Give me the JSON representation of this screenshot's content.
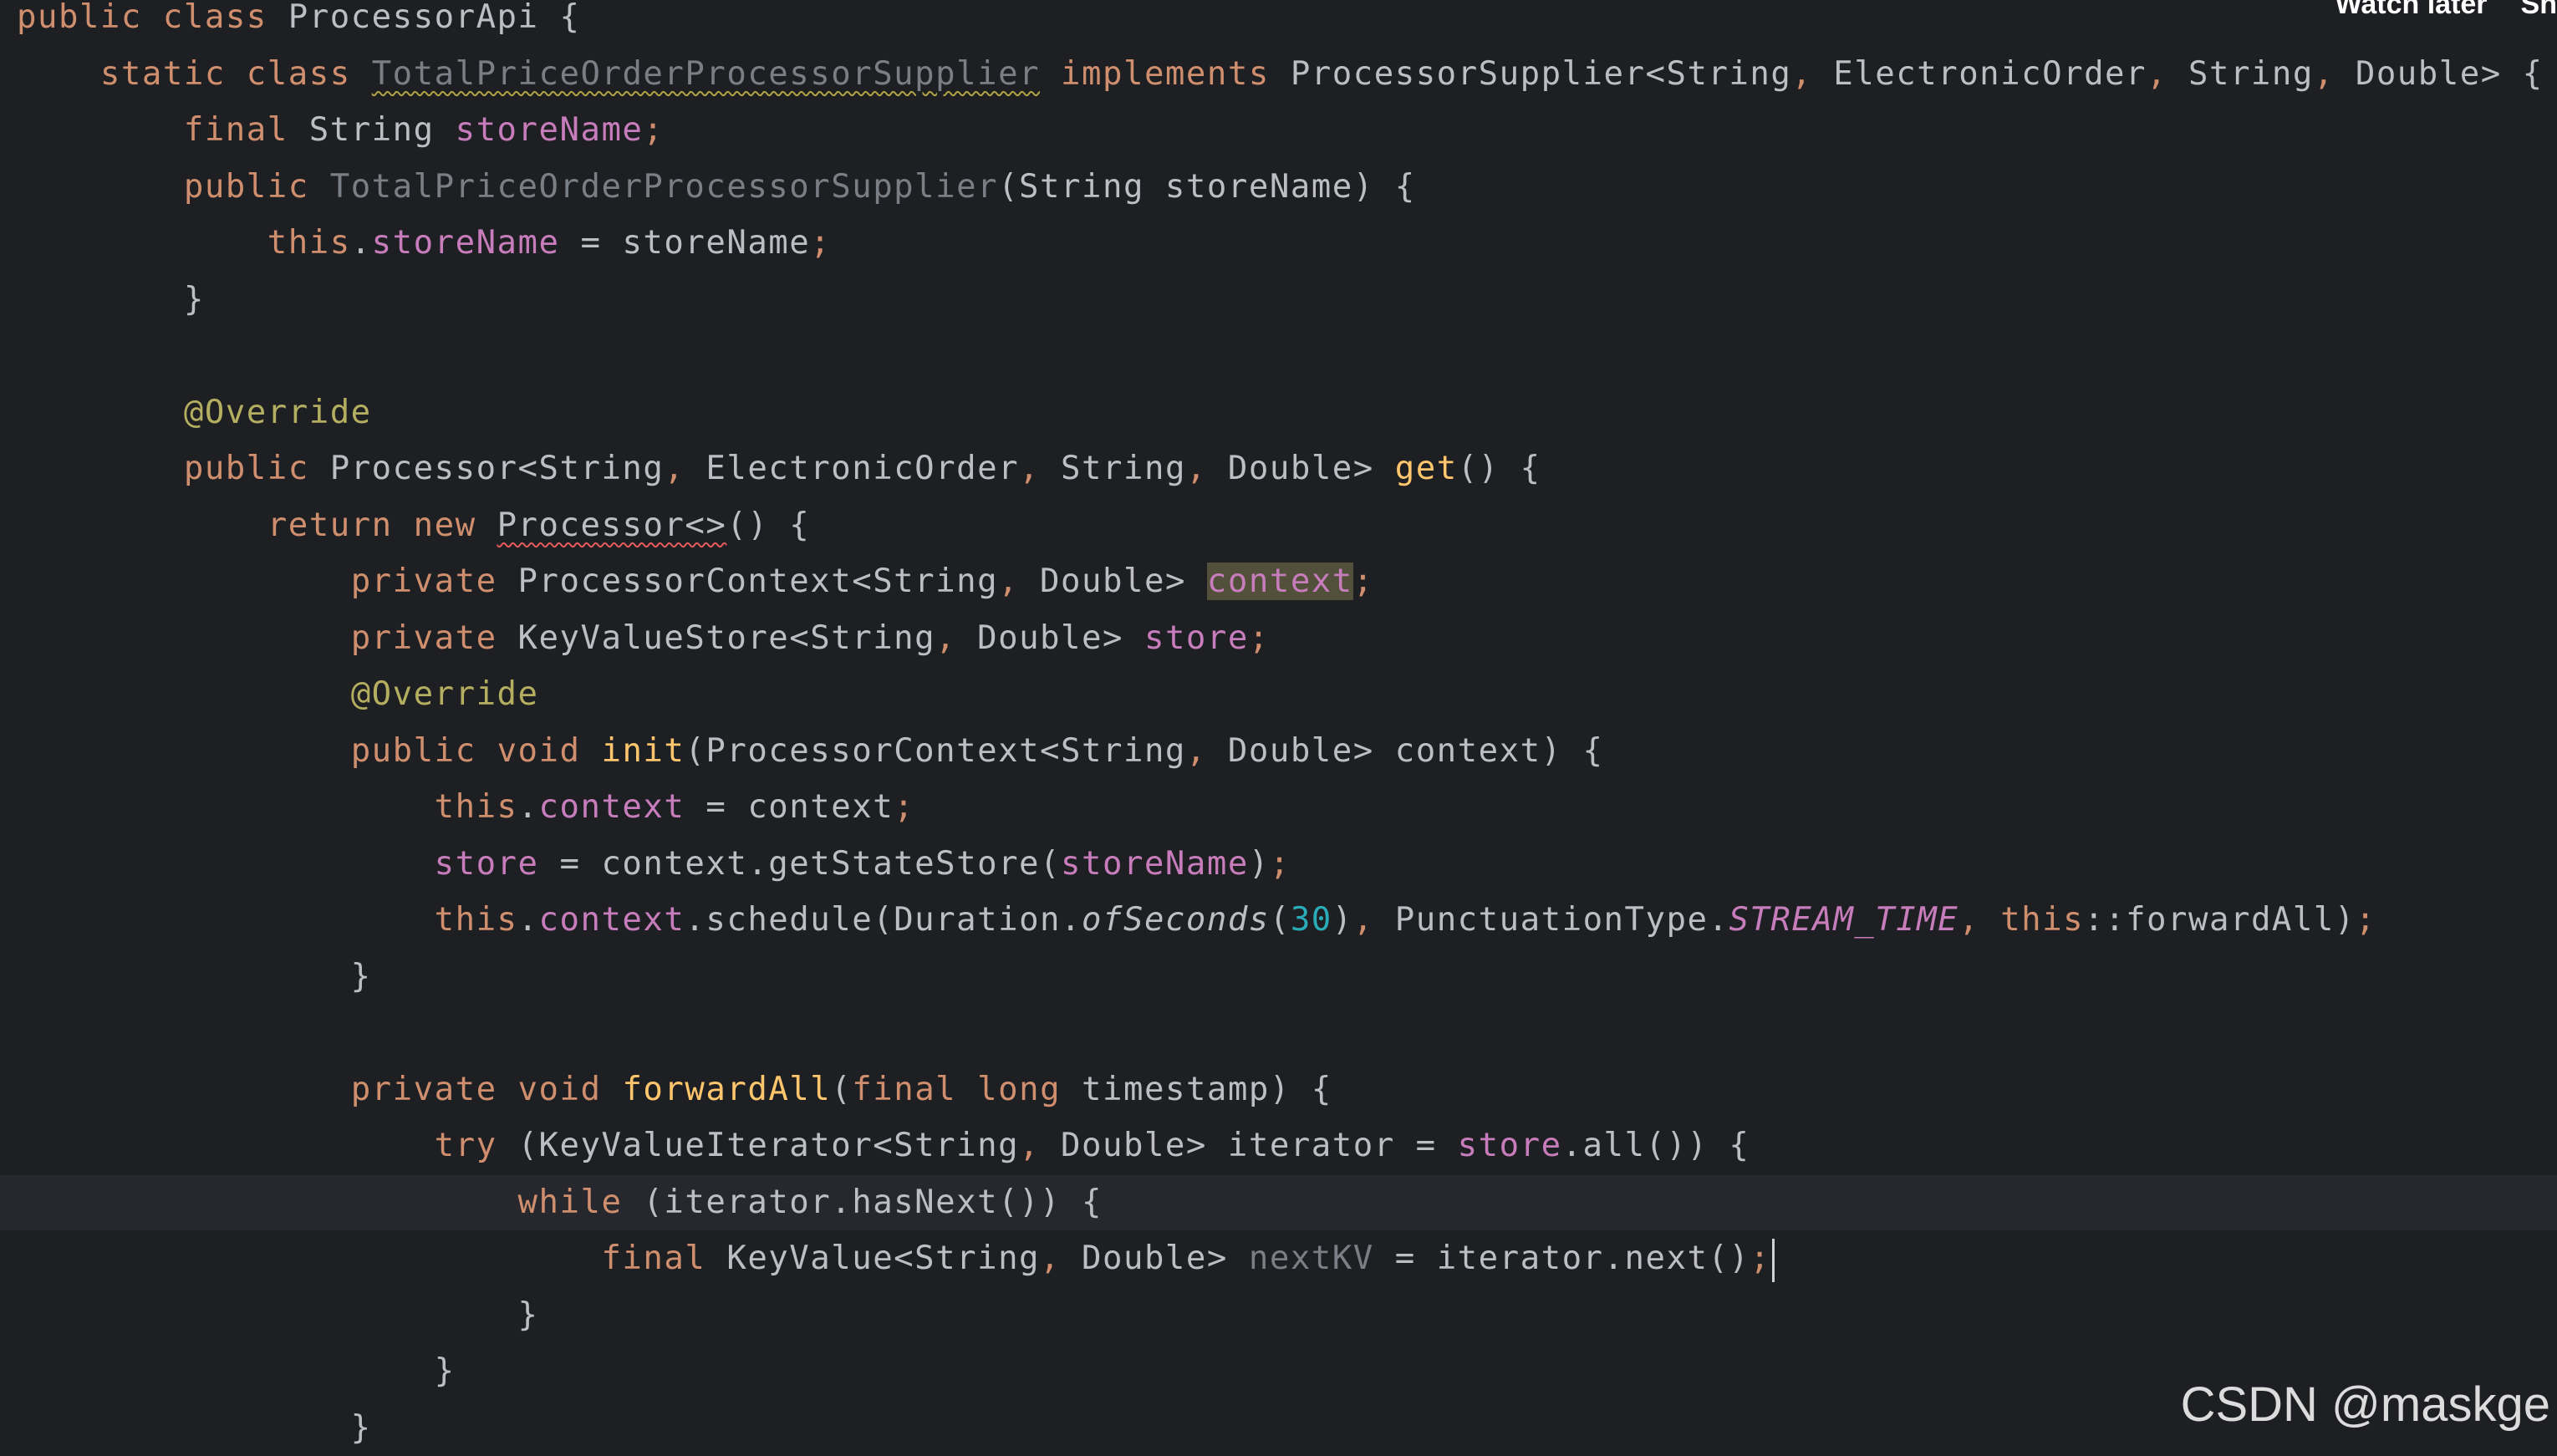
{
  "overlay": {
    "watch_later": "Watch later",
    "share_truncated": "Sh"
  },
  "watermark": "CSDN @maskge",
  "colors": {
    "background": "#1e1f22",
    "keyword": "#cf8e6d",
    "identifier": "#bcbec4",
    "method_declaration": "#ffc66d",
    "field": "#c77dbb",
    "annotation": "#b3ae60",
    "number": "#2aacb8",
    "unused": "#7a7e85"
  },
  "editor": {
    "current_line_index": 21,
    "lines": [
      [
        [
          "kw",
          "public"
        ],
        [
          "id",
          " "
        ],
        [
          "kw",
          "class"
        ],
        [
          "id",
          " ProcessorApi {"
        ]
      ],
      [
        [
          "id",
          "    "
        ],
        [
          "kw",
          "static"
        ],
        [
          "id",
          " "
        ],
        [
          "kw",
          "class"
        ],
        [
          "id",
          " "
        ],
        [
          "unused-warn",
          "TotalPriceOrderProcessorSupplier"
        ],
        [
          "id",
          " "
        ],
        [
          "kw",
          "implements"
        ],
        [
          "id",
          " ProcessorSupplier<String"
        ],
        [
          "comma",
          ","
        ],
        [
          "id",
          " ElectronicOrder"
        ],
        [
          "comma",
          ","
        ],
        [
          "id",
          " String"
        ],
        [
          "comma",
          ","
        ],
        [
          "id",
          " Double> {"
        ]
      ],
      [
        [
          "id",
          "        "
        ],
        [
          "kw",
          "final"
        ],
        [
          "id",
          " String "
        ],
        [
          "field",
          "storeName"
        ],
        [
          "semi",
          ";"
        ]
      ],
      [
        [
          "id",
          "        "
        ],
        [
          "kw",
          "public"
        ],
        [
          "id",
          " "
        ],
        [
          "unused",
          "TotalPriceOrderProcessorSupplier"
        ],
        [
          "id",
          "(String storeName) {"
        ]
      ],
      [
        [
          "id",
          "            "
        ],
        [
          "kw",
          "this"
        ],
        [
          "id",
          "."
        ],
        [
          "field",
          "storeName"
        ],
        [
          "id",
          " = storeName"
        ],
        [
          "semi",
          ";"
        ]
      ],
      [
        [
          "id",
          "        }"
        ]
      ],
      [
        [
          "id",
          ""
        ]
      ],
      [
        [
          "id",
          "        "
        ],
        [
          "anno",
          "@Override"
        ]
      ],
      [
        [
          "id",
          "        "
        ],
        [
          "kw",
          "public"
        ],
        [
          "id",
          " Processor<String"
        ],
        [
          "comma",
          ","
        ],
        [
          "id",
          " ElectronicOrder"
        ],
        [
          "comma",
          ","
        ],
        [
          "id",
          " String"
        ],
        [
          "comma",
          ","
        ],
        [
          "id",
          " Double> "
        ],
        [
          "mdecl",
          "get"
        ],
        [
          "id",
          "() {"
        ]
      ],
      [
        [
          "id",
          "            "
        ],
        [
          "kw",
          "return"
        ],
        [
          "id",
          " "
        ],
        [
          "kw",
          "new"
        ],
        [
          "id",
          " "
        ],
        [
          "err",
          "Processor<>"
        ],
        [
          "id",
          "() {"
        ]
      ],
      [
        [
          "id",
          "                "
        ],
        [
          "kw",
          "private"
        ],
        [
          "id",
          " ProcessorContext<String"
        ],
        [
          "comma",
          ","
        ],
        [
          "id",
          " Double> "
        ],
        [
          "field-hl",
          "context"
        ],
        [
          "semi",
          ";"
        ]
      ],
      [
        [
          "id",
          "                "
        ],
        [
          "kw",
          "private"
        ],
        [
          "id",
          " KeyValueStore<String"
        ],
        [
          "comma",
          ","
        ],
        [
          "id",
          " Double> "
        ],
        [
          "field",
          "store"
        ],
        [
          "semi",
          ";"
        ]
      ],
      [
        [
          "id",
          "                "
        ],
        [
          "anno",
          "@Override"
        ]
      ],
      [
        [
          "id",
          "                "
        ],
        [
          "kw",
          "public"
        ],
        [
          "id",
          " "
        ],
        [
          "kw",
          "void"
        ],
        [
          "id",
          " "
        ],
        [
          "mdecl",
          "init"
        ],
        [
          "id",
          "(ProcessorContext<String"
        ],
        [
          "comma",
          ","
        ],
        [
          "id",
          " Double> context) {"
        ]
      ],
      [
        [
          "id",
          "                    "
        ],
        [
          "kw",
          "this"
        ],
        [
          "id",
          "."
        ],
        [
          "field",
          "context"
        ],
        [
          "id",
          " = context"
        ],
        [
          "semi",
          ";"
        ]
      ],
      [
        [
          "id",
          "                    "
        ],
        [
          "field",
          "store"
        ],
        [
          "id",
          " = context.getStateStore("
        ],
        [
          "field",
          "storeName"
        ],
        [
          "id",
          ")"
        ],
        [
          "semi",
          ";"
        ]
      ],
      [
        [
          "id",
          "                    "
        ],
        [
          "kw",
          "this"
        ],
        [
          "id",
          "."
        ],
        [
          "field",
          "context"
        ],
        [
          "id",
          ".schedule(Duration."
        ],
        [
          "scall",
          "ofSeconds"
        ],
        [
          "id",
          "("
        ],
        [
          "num",
          "30"
        ],
        [
          "id",
          ")"
        ],
        [
          "comma",
          ","
        ],
        [
          "id",
          " PunctuationType."
        ],
        [
          "static",
          "STREAM_TIME"
        ],
        [
          "comma",
          ","
        ],
        [
          "id",
          " "
        ],
        [
          "kw",
          "this"
        ],
        [
          "id",
          "::forwardAll)"
        ],
        [
          "semi",
          ";"
        ]
      ],
      [
        [
          "id",
          "                }"
        ]
      ],
      [
        [
          "id",
          ""
        ]
      ],
      [
        [
          "id",
          "                "
        ],
        [
          "kw",
          "private"
        ],
        [
          "id",
          " "
        ],
        [
          "kw",
          "void"
        ],
        [
          "id",
          " "
        ],
        [
          "mdecl",
          "forwardAll"
        ],
        [
          "id",
          "("
        ],
        [
          "kw",
          "final"
        ],
        [
          "id",
          " "
        ],
        [
          "kw",
          "long"
        ],
        [
          "id",
          " timestamp) {"
        ]
      ],
      [
        [
          "id",
          "                    "
        ],
        [
          "kw",
          "try"
        ],
        [
          "id",
          " (KeyValueIterator<String"
        ],
        [
          "comma",
          ","
        ],
        [
          "id",
          " Double> iterator = "
        ],
        [
          "field",
          "store"
        ],
        [
          "id",
          ".all()) {"
        ]
      ],
      [
        [
          "id",
          "                        "
        ],
        [
          "kw",
          "while"
        ],
        [
          "id",
          " (iterator.hasNext()) {"
        ]
      ],
      [
        [
          "id",
          "                            "
        ],
        [
          "kw",
          "final"
        ],
        [
          "id",
          " KeyValue<String"
        ],
        [
          "comma",
          ","
        ],
        [
          "id",
          " Double> "
        ],
        [
          "unused",
          "nextKV"
        ],
        [
          "id",
          " = iterator.next()"
        ],
        [
          "semi",
          ";"
        ],
        [
          "caret",
          ""
        ]
      ],
      [
        [
          "id",
          "                        }"
        ]
      ],
      [
        [
          "id",
          "                    }"
        ]
      ],
      [
        [
          "id",
          "                }"
        ]
      ]
    ]
  }
}
